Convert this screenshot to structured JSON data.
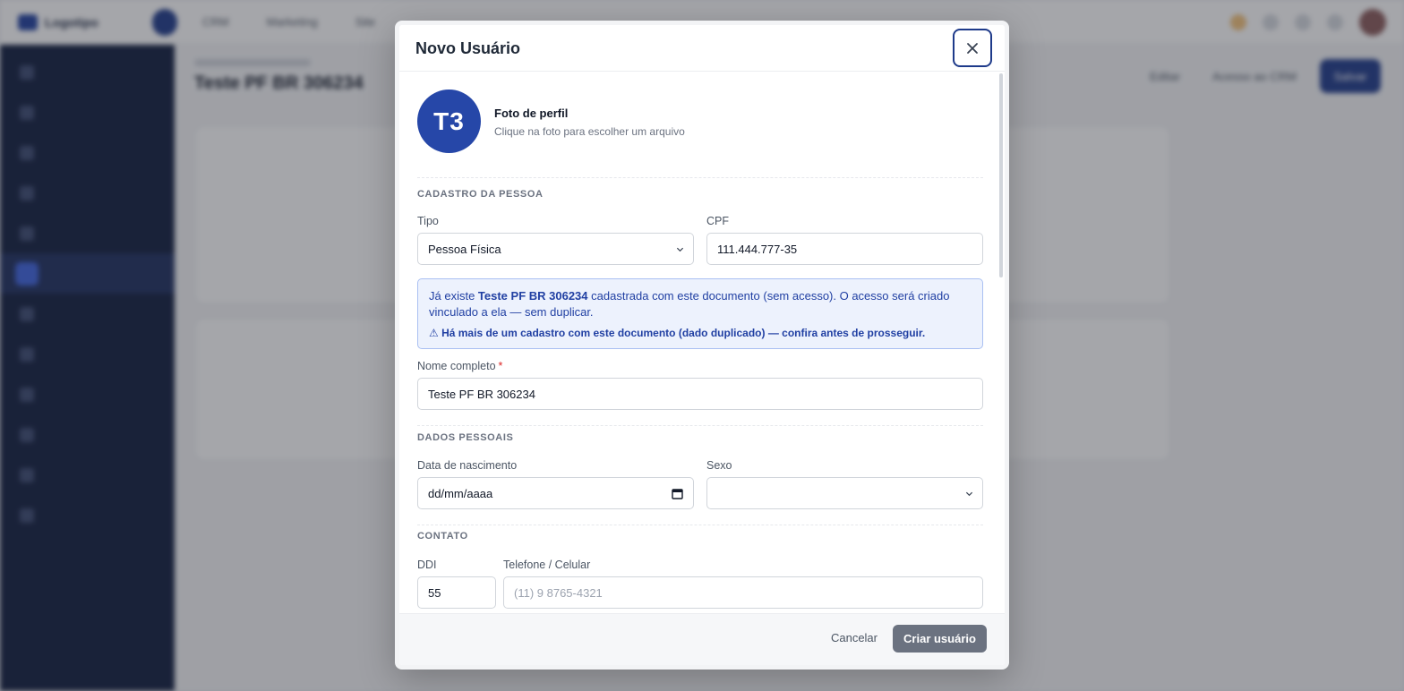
{
  "background": {
    "brand_name": "Logotipo",
    "top_nav": [
      "CRM",
      "Marketing",
      "Site"
    ],
    "page_title": "Teste PF BR 306234",
    "header_actions": [
      "Editar",
      "Acesso ao CRM",
      "Salvar"
    ]
  },
  "modal": {
    "title": "Novo Usuário",
    "avatar_initials": "T3",
    "photo": {
      "title": "Foto de perfil",
      "subtitle": "Clique na foto para escolher um arquivo"
    },
    "sections": {
      "cadastro": "CADASTRO DA PESSOA",
      "dados": "DADOS PESSOAIS",
      "contato": "CONTATO"
    },
    "fields": {
      "tipo_label": "Tipo",
      "tipo_value": "Pessoa Física",
      "cpf_label": "CPF",
      "cpf_value": "111.444.777-35",
      "nome_label": "Nome completo",
      "nome_required": "*",
      "nome_value": "Teste PF BR 306234",
      "nascimento_label": "Data de nascimento",
      "nascimento_value": "dd/mm/aaaa",
      "sexo_label": "Sexo",
      "sexo_value": "",
      "ddi_label": "DDI",
      "ddi_value": "55",
      "telefone_label": "Telefone / Celular",
      "telefone_placeholder": "(11) 9 8765-4321"
    },
    "notice": {
      "prefix": "Já existe ",
      "name": "Teste PF BR 306234",
      "suffix": " cadastrada com este documento (sem acesso). O acesso será criado vinculado a ela — sem duplicar.",
      "warning": "⚠ Há mais de um cadastro com este documento (dado duplicado) — confira antes de prosseguir."
    },
    "footer": {
      "cancel_label": "Cancelar",
      "submit_label": "Criar usuário"
    }
  },
  "colors": {
    "primary": "#1e3a8a",
    "avatar_bg": "#2647a8",
    "notice_bg": "#edf2fd",
    "notice_text": "#2140a3",
    "required": "#dc2626",
    "submit_disabled": "#6b7280"
  }
}
